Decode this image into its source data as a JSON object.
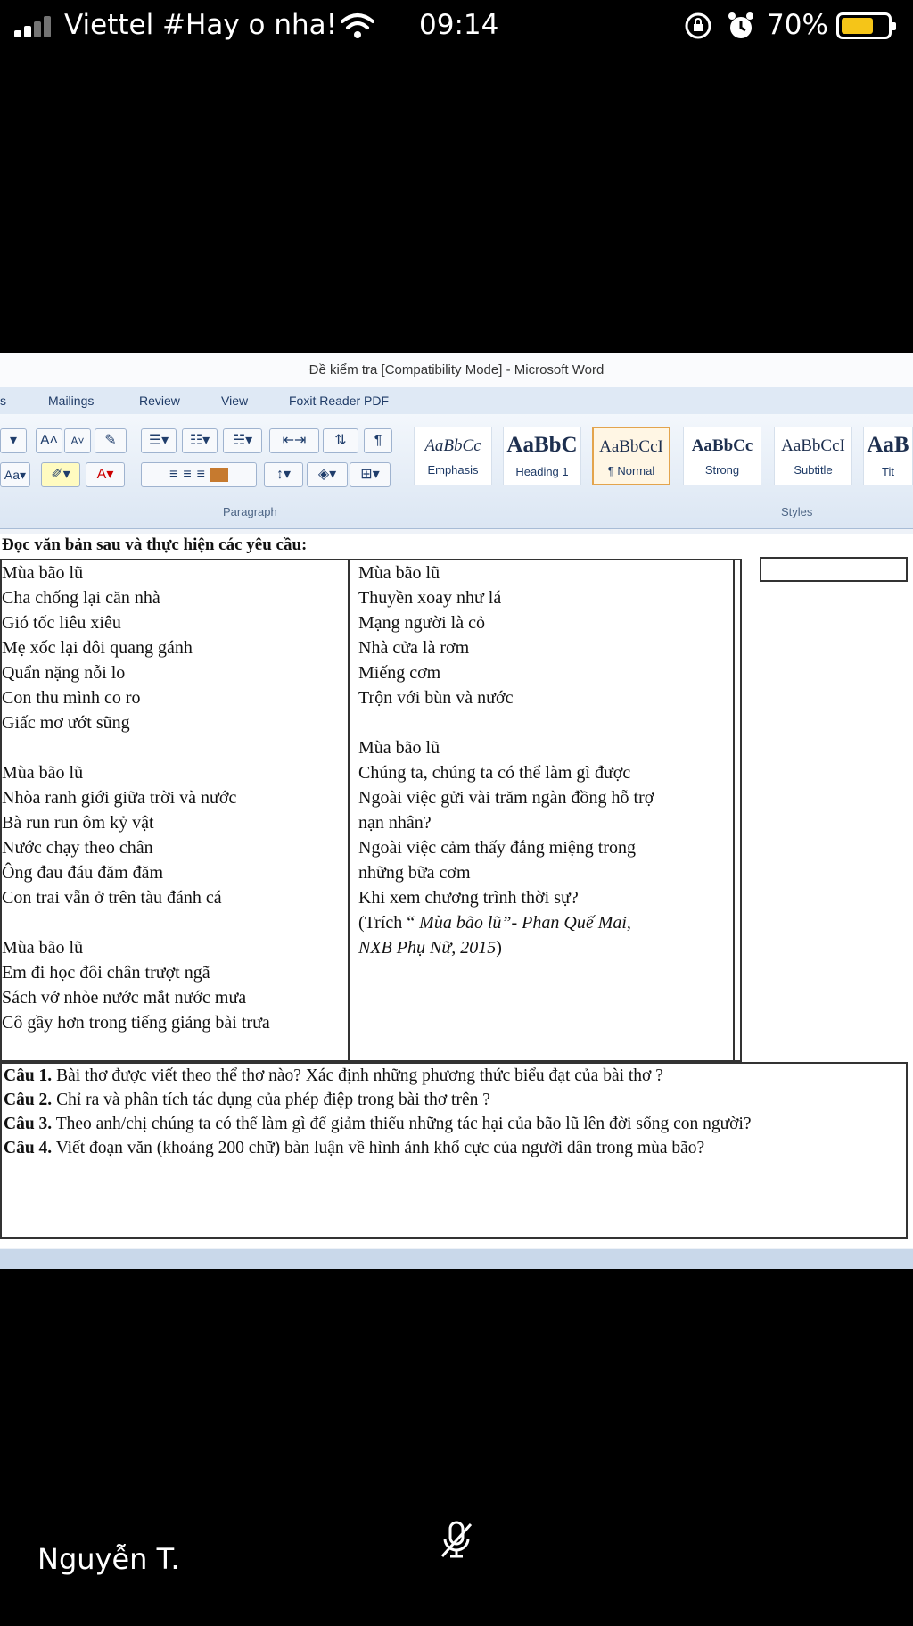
{
  "status_bar": {
    "carrier": "Viettel #Hay o nha!",
    "time": "09:14",
    "battery": "70%",
    "battery_level": 0.7,
    "icons": [
      "signal-icon",
      "wifi-icon",
      "rotation-lock-icon",
      "alarm-icon",
      "battery-icon"
    ]
  },
  "word": {
    "title": "Đề kiểm tra [Compatibility Mode] - Microsoft Word",
    "tabs": [
      "s",
      "Mailings",
      "Review",
      "View",
      "Foxit Reader PDF"
    ],
    "groups": {
      "paragraph": "Paragraph",
      "styles": "Styles"
    },
    "font_buttons": {
      "aa": "Aa",
      "grow": "A",
      "shrink": "A"
    },
    "styles": [
      {
        "sample": "AaBbCc",
        "name": "Emphasis"
      },
      {
        "sample": "AaBbC",
        "name": "Heading 1"
      },
      {
        "sample": "AaBbCcI",
        "name": "¶ Normal"
      },
      {
        "sample": "AaBbCc",
        "name": "Strong"
      },
      {
        "sample": "AaBbCcI",
        "name": "Subtitle"
      },
      {
        "sample": "AaB",
        "name": "Tit"
      }
    ]
  },
  "document": {
    "intro": "Đọc văn bản sau và thực hiện các yêu cầu:",
    "left_column": [
      "Mùa bão lũ",
      "Cha chống lại căn nhà",
      "Gió tốc liêu xiêu",
      "Mẹ xốc lại đôi quang gánh",
      "Quẩn nặng nỗi lo",
      "Con thu mình co ro",
      "Giấc mơ ướt sũng",
      "",
      "Mùa bão lũ",
      "Nhòa ranh giới giữa trời và nước",
      "Bà run run ôm kỷ vật",
      "Nước chạy theo chân",
      "Ông đau đáu đăm đăm",
      "Con trai vẫn ở trên tàu đánh cá",
      "",
      "Mùa bão lũ",
      "Em đi học đôi chân trượt ngã",
      "Sách vở nhòe nước mắt nước mưa",
      "Cô gầy hơn trong tiếng giảng bài trưa"
    ],
    "right_column": [
      "Mùa bão lũ",
      "Thuyền xoay như lá",
      "Mạng người là cỏ",
      "Nhà cửa là rơm",
      "Miếng cơm",
      "Trộn với bùn và nước",
      "",
      "Mùa bão lũ",
      "Chúng ta, chúng ta có thể làm gì được",
      "Ngoài việc gửi vài trăm ngàn đồng hỗ trợ",
      "nạn nhân?",
      "Ngoài   việc   cảm   thấy   đắng   miệng   trong",
      "những bữa cơm",
      "Khi xem chương trình thời sự?"
    ],
    "citation": {
      "prefix": "(Trích  “ ",
      "title_part": "Mùa bão lũ”- Phan Quế Mai,",
      "publisher": "NXB Phụ Nữ, 2015",
      "suffix": ")"
    },
    "questions": [
      {
        "label": "Câu 1.",
        "text": " Bài thơ được viết theo thể thơ nào? Xác định những phương thức biểu đạt của bài thơ ?"
      },
      {
        "label": "Câu 2.",
        "text": " Chỉ ra và phân tích tác dụng của phép điệp trong bài thơ trên ?"
      },
      {
        "label": "Câu 3.",
        "text": " Theo anh/chị chúng ta có thể làm gì để giảm thiểu những tác hại của bão lũ lên đời sống con người?"
      },
      {
        "label": "Câu 4.",
        "text": " Viết đoạn văn (khoảng 200 chữ) bàn luận về hình ảnh khổ cực của người dân trong mùa bão?"
      }
    ]
  },
  "call": {
    "caller_name": "Nguyễn T.",
    "mic_icon": "mic-muted-icon"
  }
}
